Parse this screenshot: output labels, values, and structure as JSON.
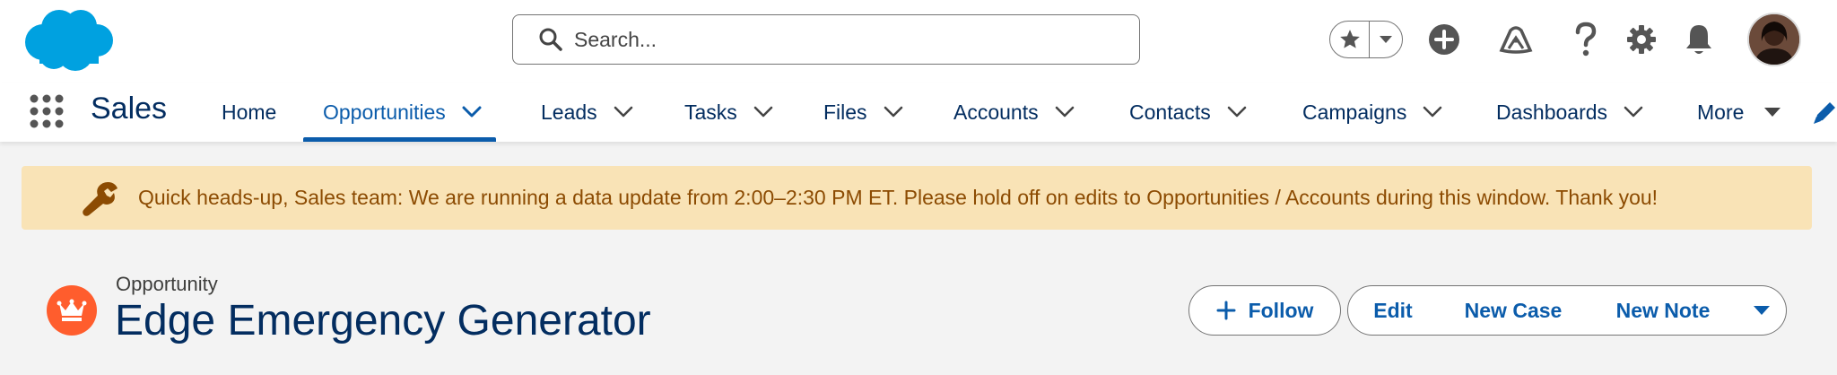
{
  "header": {
    "logo_name": "salesforce-cloud-logo",
    "search": {
      "placeholder": "Search..."
    },
    "icons": [
      "favorites-star-icon",
      "favorites-dropdown-icon",
      "global-create-icon",
      "trailhead-icon",
      "help-icon",
      "setup-gear-icon",
      "notifications-bell-icon"
    ]
  },
  "nav": {
    "app_name": "Sales",
    "items": [
      {
        "label": "Home",
        "has_menu": false
      },
      {
        "label": "Opportunities",
        "has_menu": true,
        "active": true
      },
      {
        "label": "Leads",
        "has_menu": true
      },
      {
        "label": "Tasks",
        "has_menu": true
      },
      {
        "label": "Files",
        "has_menu": true
      },
      {
        "label": "Accounts",
        "has_menu": true
      },
      {
        "label": "Contacts",
        "has_menu": true
      },
      {
        "label": "Campaigns",
        "has_menu": true
      },
      {
        "label": "Dashboards",
        "has_menu": true
      }
    ],
    "more_label": "More"
  },
  "banner": {
    "message": "Quick heads-up, Sales team: We are running a data update from 2:00–2:30 PM ET. Please hold off on edits to Opportunities / Accounts during this window. Thank you!"
  },
  "record": {
    "type_label": "Opportunity",
    "title": "Edge Emergency Generator"
  },
  "actions": {
    "follow": "Follow",
    "edit": "Edit",
    "new_case": "New Case",
    "new_note": "New Note"
  },
  "colors": {
    "brand_blue": "#0b5cab",
    "navy": "#032d60",
    "banner_bg": "#f9e3b6",
    "banner_text": "#8c4b02",
    "record_icon": "#ff5d2d",
    "salesforce_cloud": "#00a1e0"
  }
}
